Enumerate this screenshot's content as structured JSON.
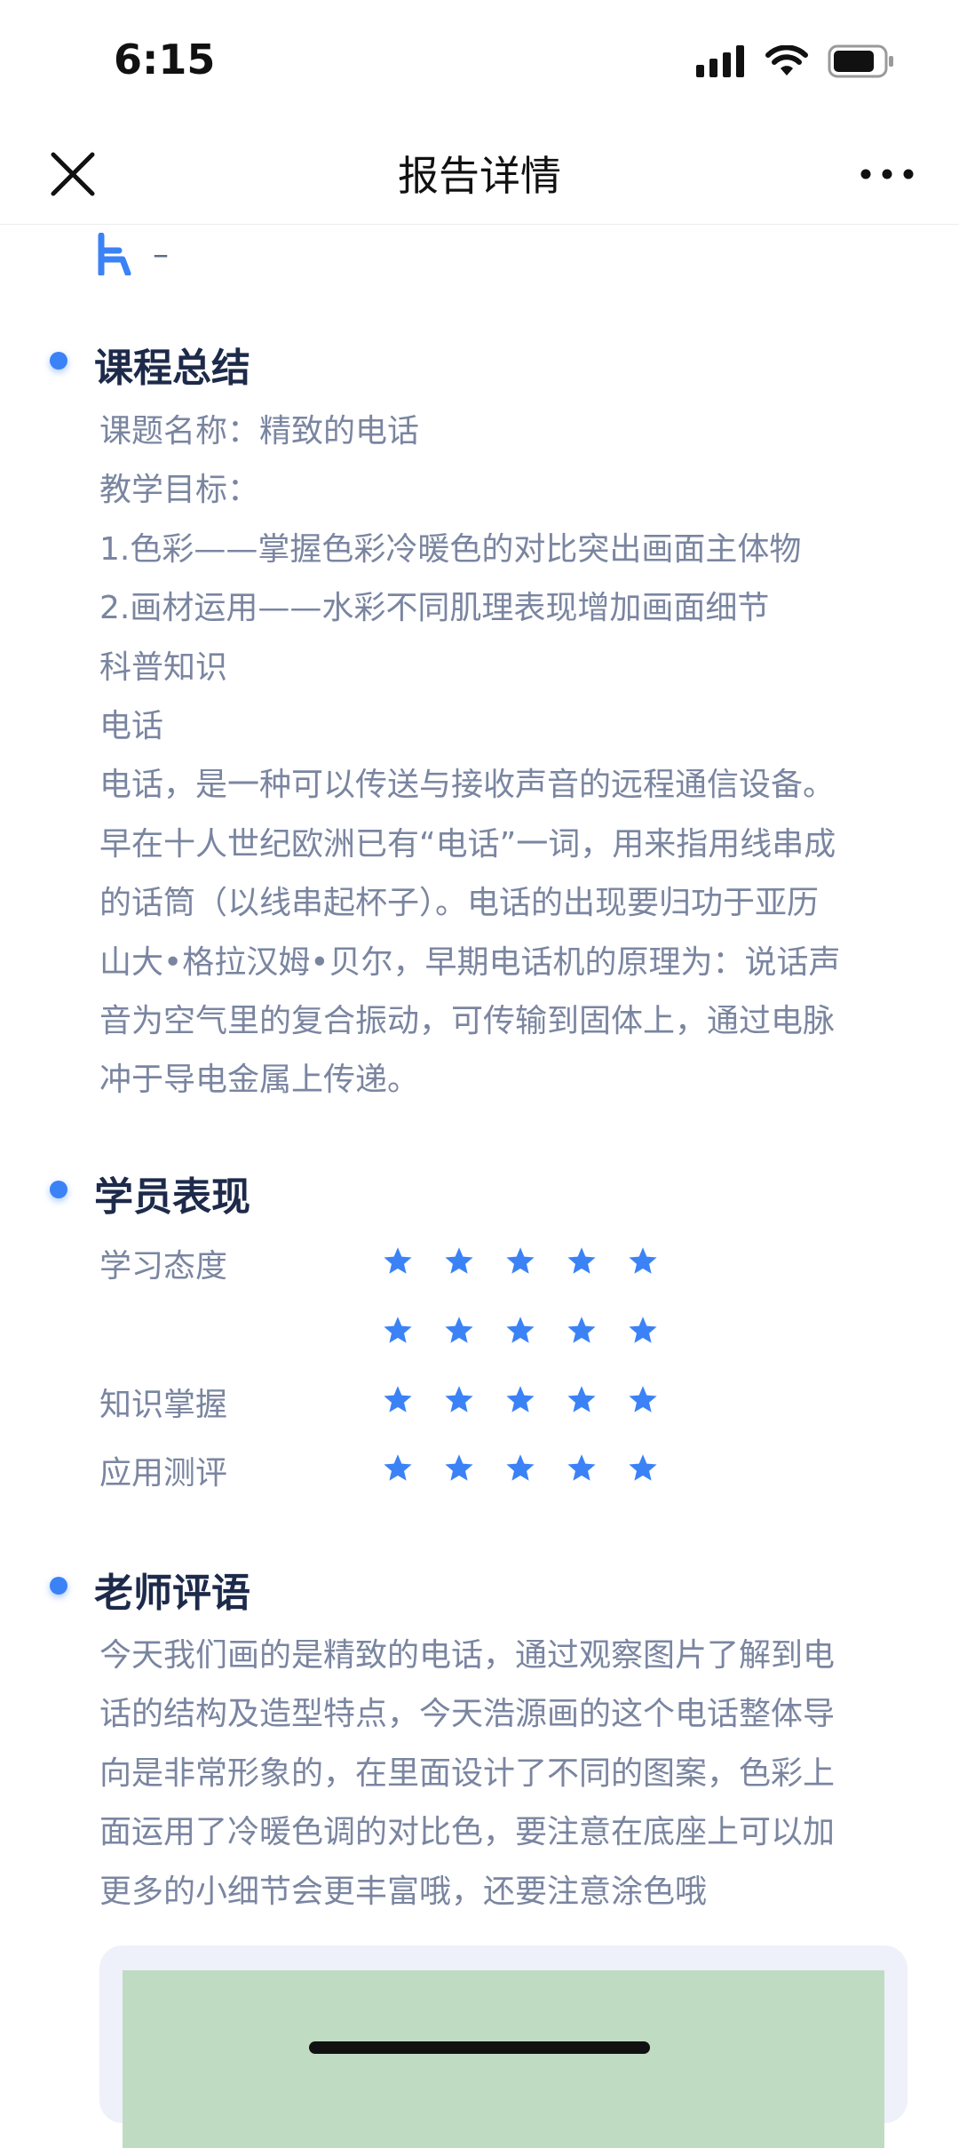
{
  "status_bar": {
    "time": "6:15",
    "icons": [
      "signal-icon",
      "wifi-icon",
      "battery-icon"
    ]
  },
  "nav": {
    "title": "报告详情",
    "left_icon": "close-icon",
    "right_icon": "more-icon"
  },
  "top_row": {
    "icon": "chair-icon",
    "text": "–"
  },
  "course_summary": {
    "title": "课程总结",
    "lines": [
      "课题名称：精致的电话",
      "教学目标：",
      "1.色彩——掌握色彩冷暖色的对比突出画面主体物",
      "2.画材运用——水彩不同肌理表现增加画面细节",
      "科普知识",
      "电话",
      "电话，是一种可以传送与接收声音的远程通信设备。",
      "早在十人世纪欧洲已有“电话”一词，用来指用线串成",
      "的话筒（以线串起杯子）。电话的出现要归功于亚历",
      "山大•格拉汉姆•贝尔，早期电话机的原理为：说话声",
      "音为空气里的复合振动，可传输到固体上，通过电脉",
      "冲于导电金属上传递。"
    ]
  },
  "student_performance": {
    "title": "学员表现",
    "ratings": [
      {
        "label": "学习态度",
        "stars": 5,
        "max": 5
      },
      {
        "label": "",
        "stars": 5,
        "max": 5
      },
      {
        "label": "知识掌握",
        "stars": 5,
        "max": 5
      },
      {
        "label": "应用测评",
        "stars": 5,
        "max": 5
      }
    ]
  },
  "teacher_comment": {
    "title": "老师评语",
    "lines": [
      "今天我们画的是精致的电话，通过观察图片了解到电",
      "话的结构及造型特点，今天浩源画的这个电话整体导",
      "向是非常形象的，在里面设计了不同的图案，色彩上",
      "面运用了冷暖色调的对比色，要注意在底座上可以加",
      "更多的小细节会更丰富哦，还要注意涂色哦"
    ]
  },
  "colors": {
    "accent": "#3b82f6",
    "heading": "#1d2a4a",
    "body_text": "#7a85a0"
  }
}
